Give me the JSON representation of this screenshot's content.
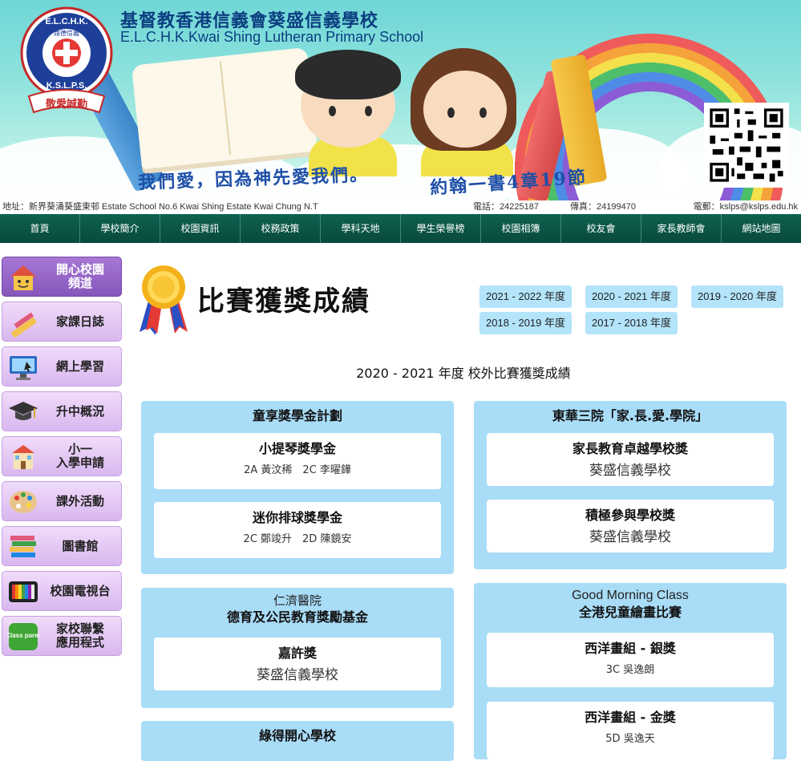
{
  "header": {
    "logo": {
      "ring_text": "E.L.C.H.K.",
      "bottom_text": "K.S.L.P.S.",
      "inner_text": "路德信義",
      "ribbon_text": "敬愛誠勤"
    },
    "school_name_zh": "基督教香港信義會葵盛信義學校",
    "school_name_en": "E.L.C.H.K.Kwai Shing Lutheran Primary School",
    "motto": "我們愛，因為神先愛我們。",
    "verse": "約翰一書4章19節"
  },
  "infobar": {
    "address": "地址：新界葵涌葵盛東邨 Estate School No.6 Kwai Shing Estate Kwai Chung N.T",
    "phone": "電話：24225187",
    "fax": "傳真：24199470",
    "email": "電郵：kslps@kslps.edu.hk"
  },
  "nav": {
    "items": [
      {
        "label": "首頁"
      },
      {
        "label": "學校簡介"
      },
      {
        "label": "校園資訊"
      },
      {
        "label": "校務政策"
      },
      {
        "label": "學科天地"
      },
      {
        "label": "學生榮譽榜"
      },
      {
        "label": "校園相簿"
      },
      {
        "label": "校友會"
      },
      {
        "label": "家長教師會"
      },
      {
        "label": "網站地圖"
      }
    ]
  },
  "sidebar": {
    "items": [
      {
        "label": "開心校園\n頻道",
        "icon": "house-icon"
      },
      {
        "label": "家課日誌",
        "icon": "pencil-ruler-icon"
      },
      {
        "label": "網上學習",
        "icon": "monitor-icon"
      },
      {
        "label": "升中概況",
        "icon": "graduation-cap-icon"
      },
      {
        "label": "小一\n入學申請",
        "icon": "school-building-icon"
      },
      {
        "label": "課外活動",
        "icon": "palette-icon"
      },
      {
        "label": "圖書館",
        "icon": "books-icon"
      },
      {
        "label": "校園電視台",
        "icon": "tv-icon"
      },
      {
        "label": "家校聯繫\n應用程式",
        "icon": "eclass-app-icon",
        "icon_text": "eClass parent"
      }
    ]
  },
  "content": {
    "title": "比賽獲獎成績",
    "years": [
      "2021 - 2022 年度",
      "2020 - 2021 年度",
      "2019 - 2020 年度",
      "2018 - 2019 年度",
      "2017 - 2018 年度"
    ],
    "section_title": "2020 - 2021 年度 校外比賽獲獎成績",
    "panels": [
      {
        "title": "童享獎學金計劃",
        "cards": [
          {
            "title": "小提琴獎學金",
            "body": "2A 黃汶稀　2C 李曜鏵"
          },
          {
            "title": "迷你排球獎學金",
            "body": "2C 鄭竣升　2D 陳鏡安"
          }
        ]
      },
      {
        "title": "東華三院「家.長.愛.學院」",
        "cards": [
          {
            "title": "家長教育卓越學校獎",
            "body": "葵盛信義學校"
          },
          {
            "title": "積極參與學校獎",
            "body": "葵盛信義學校"
          }
        ]
      },
      {
        "subtitle": "仁濟醫院",
        "title": "德育及公民教育獎勵基金",
        "cards": [
          {
            "title": "嘉許獎",
            "body": "葵盛信義學校"
          }
        ]
      },
      {
        "subtitle": "Good Morning Class",
        "title": "全港兒童繪畫比賽",
        "cards": [
          {
            "title": "西洋畫組 - 銀獎",
            "body": "3C 吳逸朗"
          },
          {
            "title": "西洋畫組 - 金獎",
            "body": "5D 吳逸天"
          }
        ]
      },
      {
        "title": "綠得開心學校",
        "cards": []
      }
    ]
  }
}
